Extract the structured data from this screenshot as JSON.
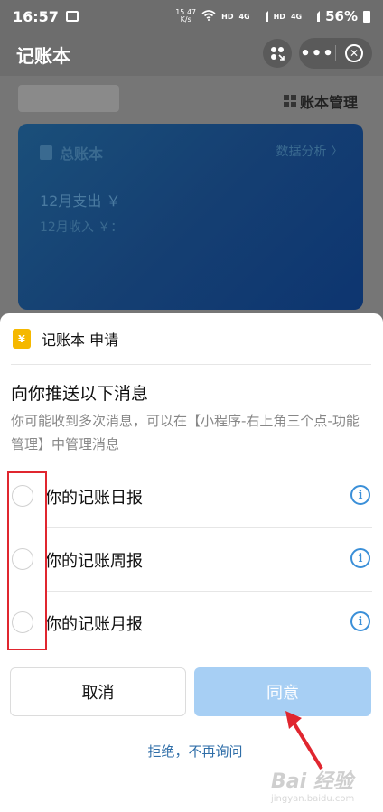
{
  "status_bar": {
    "time": "16:57",
    "net_speed_top": "15.47",
    "net_speed_bottom": "K/s",
    "hd1": "HD",
    "sig1": "4G",
    "hd2": "HD",
    "sig2": "4G",
    "battery": "56%"
  },
  "nav": {
    "title": "记账本",
    "more_glyph": "•••",
    "close_glyph": "✕"
  },
  "background": {
    "manage_label": "账本管理",
    "card": {
      "book_label": "总账本",
      "analysis_label": "数据分析 〉",
      "expense_label": "12月支出 ￥",
      "income_label": "12月收入 ￥："
    }
  },
  "sheet": {
    "app_icon_glyph": "¥",
    "app_name": "记账本 申请",
    "title": "向你推送以下消息",
    "description": "你可能收到多次消息，可以在【小程序-右上角三个点-功能管理】中管理消息",
    "options": [
      {
        "label": "你的记账日报",
        "checked": false
      },
      {
        "label": "你的记账周报",
        "checked": false
      },
      {
        "label": "你的记账月报",
        "checked": false
      }
    ],
    "info_glyph": "i",
    "cancel_label": "取消",
    "agree_label": "同意",
    "refuse_label": "拒绝，不再询问"
  },
  "watermark": {
    "main": "Bai 经验",
    "sub": "jingyan.baidu.com"
  },
  "colors": {
    "accent_blue": "#3a8fd8",
    "agree_disabled": "#a7cff4",
    "highlight_red": "#e0262f",
    "app_icon_yellow": "#f5b800"
  }
}
